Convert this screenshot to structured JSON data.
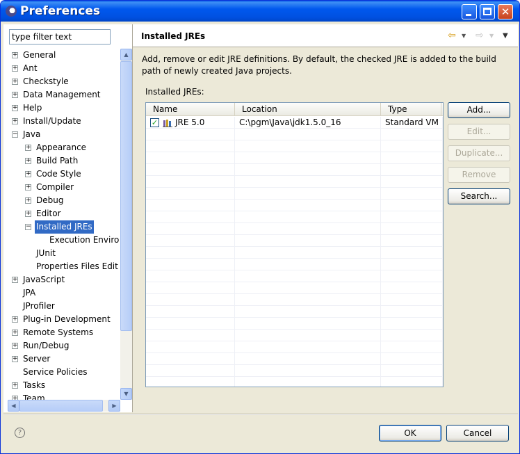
{
  "window": {
    "title": "Preferences"
  },
  "sidebar": {
    "filter_value": "type filter text",
    "tree": [
      {
        "label": "General",
        "expander": "+"
      },
      {
        "label": "Ant",
        "expander": "+"
      },
      {
        "label": "Checkstyle",
        "expander": "+"
      },
      {
        "label": "Data Management",
        "expander": "+"
      },
      {
        "label": "Help",
        "expander": "+"
      },
      {
        "label": "Install/Update",
        "expander": "+"
      },
      {
        "label": "Java",
        "expander": "−"
      },
      {
        "label": "Appearance",
        "expander": "+"
      },
      {
        "label": "Build Path",
        "expander": "+"
      },
      {
        "label": "Code Style",
        "expander": "+"
      },
      {
        "label": "Compiler",
        "expander": "+"
      },
      {
        "label": "Debug",
        "expander": "+"
      },
      {
        "label": "Editor",
        "expander": "+"
      },
      {
        "label": "Installed JREs",
        "expander": "−",
        "selected": true
      },
      {
        "label": "Execution Enviro",
        "expander": ""
      },
      {
        "label": "JUnit",
        "expander": ""
      },
      {
        "label": "Properties Files Edit",
        "expander": ""
      },
      {
        "label": "JavaScript",
        "expander": "+"
      },
      {
        "label": "JPA",
        "expander": ""
      },
      {
        "label": "JProfiler",
        "expander": ""
      },
      {
        "label": "Plug-in Development",
        "expander": "+"
      },
      {
        "label": "Remote Systems",
        "expander": "+"
      },
      {
        "label": "Run/Debug",
        "expander": "+"
      },
      {
        "label": "Server",
        "expander": "+"
      },
      {
        "label": "Service Policies",
        "expander": ""
      },
      {
        "label": "Tasks",
        "expander": "+"
      },
      {
        "label": "Team",
        "expander": "+"
      }
    ]
  },
  "main": {
    "page_title": "Installed JREs",
    "description": "Add, remove or edit JRE definitions. By default, the checked JRE is added to the build path of newly created Java projects.",
    "list_label": "Installed JREs:",
    "columns": [
      "Name",
      "Location",
      "Type"
    ],
    "rows": [
      {
        "name": "JRE 5.0",
        "location": "C:\\pgm\\Java\\jdk1.5.0_16",
        "type": "Standard VM",
        "checked": true
      }
    ],
    "buttons": {
      "add": "Add...",
      "edit": "Edit...",
      "duplicate": "Duplicate...",
      "remove": "Remove",
      "search": "Search..."
    }
  },
  "footer": {
    "ok": "OK",
    "cancel": "Cancel"
  },
  "icons": {
    "title": "eclipse-icon",
    "back": "back-arrow-icon",
    "forward": "forward-arrow-icon",
    "menu": "view-menu-icon",
    "help": "help-icon",
    "jre": "jre-library-icon"
  }
}
